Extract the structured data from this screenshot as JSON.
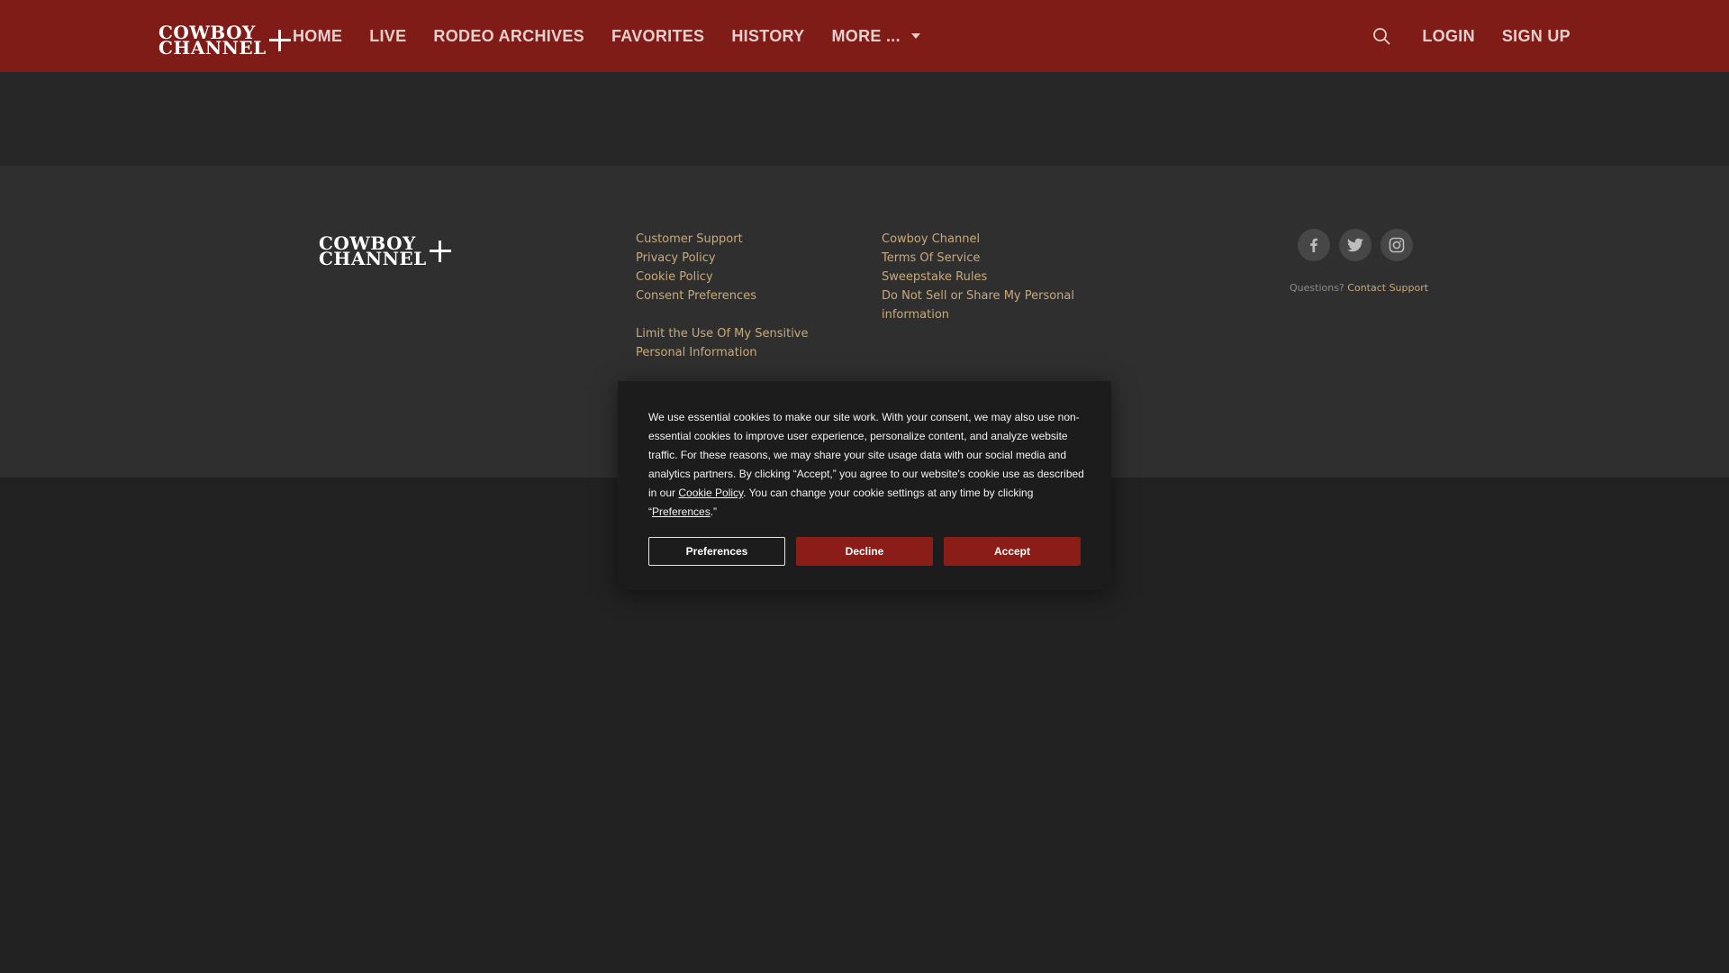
{
  "brand": {
    "logo_line1": "COWBOY",
    "logo_line2": "CHANNEL"
  },
  "nav": {
    "items": [
      "HOME",
      "LIVE",
      "RODEO ARCHIVES",
      "FAVORITES",
      "HISTORY",
      "MORE ..."
    ],
    "login": "LOGIN",
    "signup": "SIGN UP"
  },
  "footer": {
    "col1": [
      "Customer Support",
      "Privacy Policy",
      "Cookie Policy",
      "Consent Preferences",
      "Limit the Use Of My Sensitive Personal Information"
    ],
    "col2": [
      "Cowboy Channel",
      "Terms Of Service",
      "Sweepstake Rules",
      "Do Not Sell or Share My Personal information"
    ],
    "questions_label": "Questions?",
    "contact_link": "Contact Support",
    "social_icons": [
      "facebook-icon",
      "twitter-icon",
      "instagram-icon"
    ]
  },
  "cookie": {
    "text_part1": "We use essential cookies to make our site work. With your consent, we may also use non-essential cookies to improve user experience, personalize content, and analyze website traffic. For these reasons, we may share your site usage data with our social media and analytics partners. By clicking “Accept,” you agree to our website's cookie use as described in our ",
    "cookie_policy_link": "Cookie Policy",
    "text_part2": ". You can change your cookie settings at any time by clicking “",
    "preferences_link": "Preferences",
    "text_part3": ".”",
    "preferences_button": "Preferences",
    "decline_button": "Decline",
    "accept_button": "Accept"
  },
  "colors": {
    "header_bg": "#7f1c18",
    "page_bg": "#222222",
    "footer_bg": "#2f2f2f",
    "link_color": "#c9a97a",
    "button_red": "#8b1d18"
  }
}
